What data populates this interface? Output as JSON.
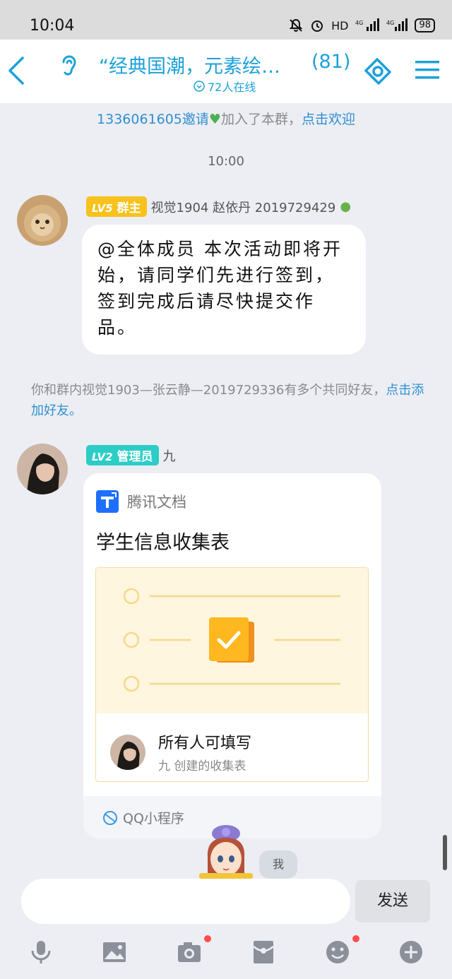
{
  "status_bar": {
    "time": "10:04",
    "network": "HD",
    "battery": "98"
  },
  "header": {
    "title": "“经典国潮，元素绘…",
    "member_count": "(81)",
    "online": "72人在线"
  },
  "messages": {
    "join_notice": {
      "prefix": "1336061605邀请",
      "middle": "加入了本群，",
      "link": "点击欢迎"
    },
    "time": "10:00",
    "owner_msg": {
      "badge_level": "LV5",
      "badge_role": "群主",
      "name": "视觉1904 赵依丹 2019729429",
      "text": "@全体成员 本次活动即将开始，请同学们先进行签到，签到完成后请尽快提交作品。"
    },
    "friend_notice": {
      "text": "你和群内视觉1903—张云静—2019729336有多个共同好友，",
      "link": "点击添加好友。"
    },
    "admin_msg": {
      "badge_level": "LV2",
      "badge_role": "管理员",
      "name": "九",
      "card": {
        "app_name": "腾讯文档",
        "title": "学生信息收集表",
        "permission": "所有人可填写",
        "creator": "九 创建的收集表",
        "footer": "QQ小程序"
      }
    },
    "self_label": "我"
  },
  "composer": {
    "send_label": "发送"
  },
  "colors": {
    "accent": "#1da1d8",
    "gold": "#f7c21d",
    "teal": "#2ccdc6"
  }
}
